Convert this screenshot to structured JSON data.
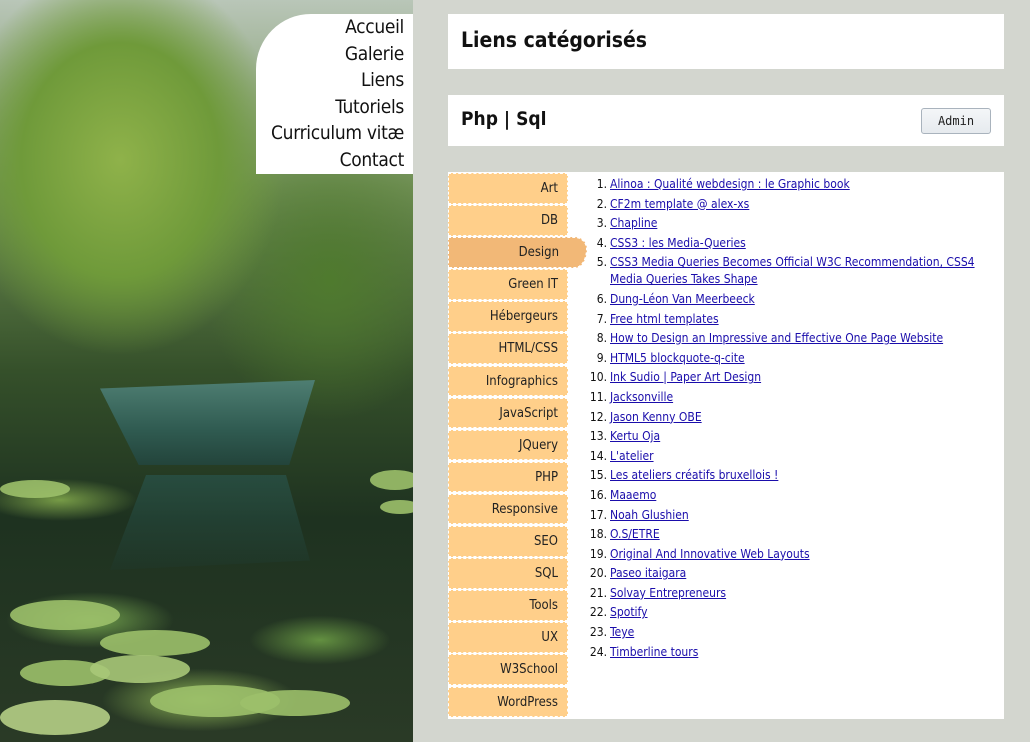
{
  "nav": {
    "items": [
      "Accueil",
      "Galerie",
      "Liens",
      "Tutoriels",
      "Curriculum vitæ",
      "Contact"
    ]
  },
  "header": {
    "title": "Liens catégorisés"
  },
  "section": {
    "title": "Php | Sql",
    "admin_label": "Admin"
  },
  "categories": {
    "items": [
      "Art",
      "DB",
      "Design",
      "Green IT",
      "Hébergeurs",
      "HTML/CSS",
      "Infographics",
      "JavaScript",
      "JQuery",
      "PHP",
      "Responsive",
      "SEO",
      "SQL",
      "Tools",
      "UX",
      "W3School",
      "WordPress"
    ],
    "active": "Design"
  },
  "links": {
    "items": [
      {
        "n": "1.",
        "label": "Alinoa : Qualité webdesign : le Graphic book"
      },
      {
        "n": "2.",
        "label": "CF2m template @ alex-xs"
      },
      {
        "n": "3.",
        "label": "Chapline"
      },
      {
        "n": "4.",
        "label": "CSS3 : les Media-Queries"
      },
      {
        "n": "5.",
        "label": "CSS3 Media Queries Becomes Official W3C Recommendation, CSS4 Media Queries Takes Shape"
      },
      {
        "n": "6.",
        "label": "Dung-Léon Van Meerbeeck"
      },
      {
        "n": "7.",
        "label": "Free html templates"
      },
      {
        "n": "8.",
        "label": "How to Design an Impressive and Effective One Page Website"
      },
      {
        "n": "9.",
        "label": "HTML5 blockquote-q-cite"
      },
      {
        "n": "10.",
        "label": "Ink Sudio | Paper Art Design"
      },
      {
        "n": "11.",
        "label": "Jacksonville"
      },
      {
        "n": "12.",
        "label": "Jason Kenny OBE"
      },
      {
        "n": "13.",
        "label": "Kertu Oja"
      },
      {
        "n": "14.",
        "label": "L'atelier"
      },
      {
        "n": "15.",
        "label": "Les ateliers créatifs bruxellois !"
      },
      {
        "n": "16.",
        "label": "Maaemo"
      },
      {
        "n": "17.",
        "label": "Noah Glushien"
      },
      {
        "n": "18.",
        "label": "O.S/ETRE"
      },
      {
        "n": "19.",
        "label": "Original And Innovative Web Layouts"
      },
      {
        "n": "20.",
        "label": "Paseo itaigara"
      },
      {
        "n": "21.",
        "label": "Solvay Entrepreneurs"
      },
      {
        "n": "22.",
        "label": "Spotify"
      },
      {
        "n": "23.",
        "label": "Teye"
      },
      {
        "n": "24.",
        "label": "Timberline tours"
      }
    ]
  },
  "colors": {
    "category_bg": "#ffcf8a",
    "category_active_bg": "#f2b877",
    "link": "#1a0dab",
    "page_bg": "#d3d6cf"
  },
  "icons": {
    "background_photo": "willow-pond-photo"
  }
}
